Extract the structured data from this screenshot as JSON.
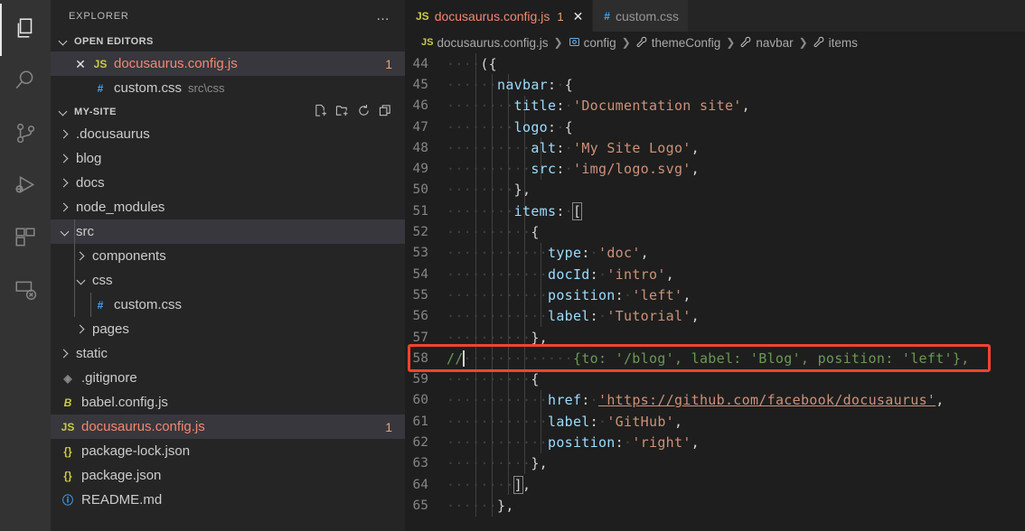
{
  "activitybar": {
    "items": [
      {
        "name": "explorer",
        "icon": "files-icon",
        "active": true
      },
      {
        "name": "search",
        "icon": "search-icon",
        "active": false
      },
      {
        "name": "source-control",
        "icon": "source-control-icon",
        "active": false
      },
      {
        "name": "run-debug",
        "icon": "run-debug-icon",
        "active": false
      },
      {
        "name": "extensions",
        "icon": "extensions-icon",
        "active": false
      },
      {
        "name": "remote-explorer",
        "icon": "remote-explorer-icon",
        "active": false
      }
    ]
  },
  "sidebar": {
    "title": "EXPLORER",
    "more_actions": "…",
    "open_editors": {
      "label": "OPEN EDITORS",
      "items": [
        {
          "icon": "JS",
          "icon_class": "ic-js",
          "name": "docusaurus.config.js",
          "sub": "",
          "badge": "1",
          "selected": true,
          "error": true
        },
        {
          "icon": "#",
          "icon_class": "ic-css",
          "name": "custom.css",
          "sub": "src\\css",
          "badge": "",
          "selected": false,
          "error": false
        }
      ]
    },
    "project": {
      "label": "MY-SITE",
      "actions": [
        "new-file-icon",
        "new-folder-icon",
        "refresh-icon",
        "collapse-all-icon"
      ],
      "items": [
        {
          "name": ".docusaurus",
          "kind": "folder",
          "expanded": false,
          "depth": 1,
          "icon": "",
          "icon_class": "",
          "badge": "",
          "selected": false,
          "error": false
        },
        {
          "name": "blog",
          "kind": "folder",
          "expanded": false,
          "depth": 1,
          "icon": "",
          "icon_class": "",
          "badge": "",
          "selected": false,
          "error": false
        },
        {
          "name": "docs",
          "kind": "folder",
          "expanded": false,
          "depth": 1,
          "icon": "",
          "icon_class": "",
          "badge": "",
          "selected": false,
          "error": false
        },
        {
          "name": "node_modules",
          "kind": "folder",
          "expanded": false,
          "depth": 1,
          "icon": "",
          "icon_class": "",
          "badge": "",
          "selected": false,
          "error": false
        },
        {
          "name": "src",
          "kind": "folder",
          "expanded": true,
          "depth": 1,
          "icon": "",
          "icon_class": "",
          "badge": "",
          "selected": true,
          "error": false
        },
        {
          "name": "components",
          "kind": "folder",
          "expanded": false,
          "depth": 2,
          "icon": "",
          "icon_class": "",
          "badge": "",
          "selected": false,
          "error": false
        },
        {
          "name": "css",
          "kind": "folder",
          "expanded": true,
          "depth": 2,
          "icon": "",
          "icon_class": "",
          "badge": "",
          "selected": false,
          "error": false
        },
        {
          "name": "custom.css",
          "kind": "file",
          "expanded": false,
          "depth": 3,
          "icon": "#",
          "icon_class": "ic-css",
          "badge": "",
          "selected": false,
          "error": false
        },
        {
          "name": "pages",
          "kind": "folder",
          "expanded": false,
          "depth": 2,
          "icon": "",
          "icon_class": "",
          "badge": "",
          "selected": false,
          "error": false
        },
        {
          "name": "static",
          "kind": "folder",
          "expanded": false,
          "depth": 1,
          "icon": "",
          "icon_class": "",
          "badge": "",
          "selected": false,
          "error": false
        },
        {
          "name": ".gitignore",
          "kind": "file",
          "expanded": false,
          "depth": 1,
          "icon": "◈",
          "icon_class": "ic-git",
          "badge": "",
          "selected": false,
          "error": false
        },
        {
          "name": "babel.config.js",
          "kind": "file",
          "expanded": false,
          "depth": 1,
          "icon": "B",
          "icon_class": "ic-babel",
          "badge": "",
          "selected": false,
          "error": false
        },
        {
          "name": "docusaurus.config.js",
          "kind": "file",
          "expanded": false,
          "depth": 1,
          "icon": "JS",
          "icon_class": "ic-js",
          "badge": "1",
          "selected": true,
          "error": true
        },
        {
          "name": "package-lock.json",
          "kind": "file",
          "expanded": false,
          "depth": 1,
          "icon": "{}",
          "icon_class": "ic-json",
          "badge": "",
          "selected": false,
          "error": false
        },
        {
          "name": "package.json",
          "kind": "file",
          "expanded": false,
          "depth": 1,
          "icon": "{}",
          "icon_class": "ic-json",
          "badge": "",
          "selected": false,
          "error": false
        },
        {
          "name": "README.md",
          "kind": "file",
          "expanded": false,
          "depth": 1,
          "icon": "ⓘ",
          "icon_class": "ic-md",
          "badge": "",
          "selected": false,
          "error": false
        }
      ]
    }
  },
  "editor": {
    "tabs": [
      {
        "icon": "JS",
        "icon_class": "ic-js",
        "label": "docusaurus.config.js",
        "badge": "1",
        "active": true,
        "closable": true,
        "close_glyph": "✕"
      },
      {
        "icon": "#",
        "icon_class": "ic-css",
        "label": "custom.css",
        "badge": "",
        "active": false,
        "closable": false,
        "close_glyph": ""
      }
    ],
    "breadcrumbs": [
      {
        "icon": "JS",
        "icon_class": "ic-js",
        "label": "docusaurus.config.js"
      },
      {
        "icon": "variable",
        "icon_class": "",
        "label": "config"
      },
      {
        "icon": "property",
        "icon_class": "",
        "label": "themeConfig"
      },
      {
        "icon": "property",
        "icon_class": "",
        "label": "navbar"
      },
      {
        "icon": "property",
        "icon_class": "",
        "label": "items"
      }
    ],
    "breadcrumb_separator": "❯",
    "first_line_number": 44,
    "lines": [
      {
        "n": 44,
        "indent": 4,
        "text": "({",
        "kind": "punc"
      },
      {
        "n": 45,
        "indent": 6,
        "text": "navbar: {",
        "kind": "prop"
      },
      {
        "n": 46,
        "indent": 8,
        "text": "title: 'Documentation site',",
        "kind": "prop"
      },
      {
        "n": 47,
        "indent": 8,
        "text": "logo: {",
        "kind": "prop"
      },
      {
        "n": 48,
        "indent": 10,
        "text": "alt: 'My Site Logo',",
        "kind": "prop"
      },
      {
        "n": 49,
        "indent": 10,
        "text": "src: 'img/logo.svg',",
        "kind": "prop"
      },
      {
        "n": 50,
        "indent": 8,
        "text": "},",
        "kind": "punc"
      },
      {
        "n": 51,
        "indent": 8,
        "text": "items: [",
        "kind": "prop-bracket"
      },
      {
        "n": 52,
        "indent": 10,
        "text": "{",
        "kind": "punc"
      },
      {
        "n": 53,
        "indent": 12,
        "text": "type: 'doc',",
        "kind": "prop"
      },
      {
        "n": 54,
        "indent": 12,
        "text": "docId: 'intro',",
        "kind": "prop"
      },
      {
        "n": 55,
        "indent": 12,
        "text": "position: 'left',",
        "kind": "prop"
      },
      {
        "n": 56,
        "indent": 12,
        "text": "label: 'Tutorial',",
        "kind": "prop"
      },
      {
        "n": 57,
        "indent": 10,
        "text": "},",
        "kind": "punc"
      },
      {
        "n": 58,
        "indent": 0,
        "text": "//",
        "kind": "comment",
        "comment_rest": "{to: '/blog', label: 'Blog', position: 'left'},",
        "comment_gap": 13,
        "cursor": true,
        "highlighted": true
      },
      {
        "n": 59,
        "indent": 10,
        "text": "{",
        "kind": "punc"
      },
      {
        "n": 60,
        "indent": 12,
        "text": "href: 'https://github.com/facebook/docusaurus',",
        "kind": "prop-link"
      },
      {
        "n": 61,
        "indent": 12,
        "text": "label: 'GitHub',",
        "kind": "prop"
      },
      {
        "n": 62,
        "indent": 12,
        "text": "position: 'right',",
        "kind": "prop"
      },
      {
        "n": 63,
        "indent": 10,
        "text": "},",
        "kind": "punc"
      },
      {
        "n": 64,
        "indent": 8,
        "text": "],",
        "kind": "bracket-close"
      },
      {
        "n": 65,
        "indent": 6,
        "text": "},",
        "kind": "punc"
      }
    ],
    "annotation": {
      "color": "#f4442e",
      "target_line": 58
    }
  },
  "colors": {
    "accent": "#007acc",
    "error": "#f48771",
    "badge": "#e2a478",
    "comment": "#6a9955",
    "string": "#ce9178",
    "property": "#9cdcfe",
    "annotation": "#f4442e",
    "editor_bg": "#1e1e1e",
    "sidebar_bg": "#252526",
    "activitybar_bg": "#333333"
  }
}
